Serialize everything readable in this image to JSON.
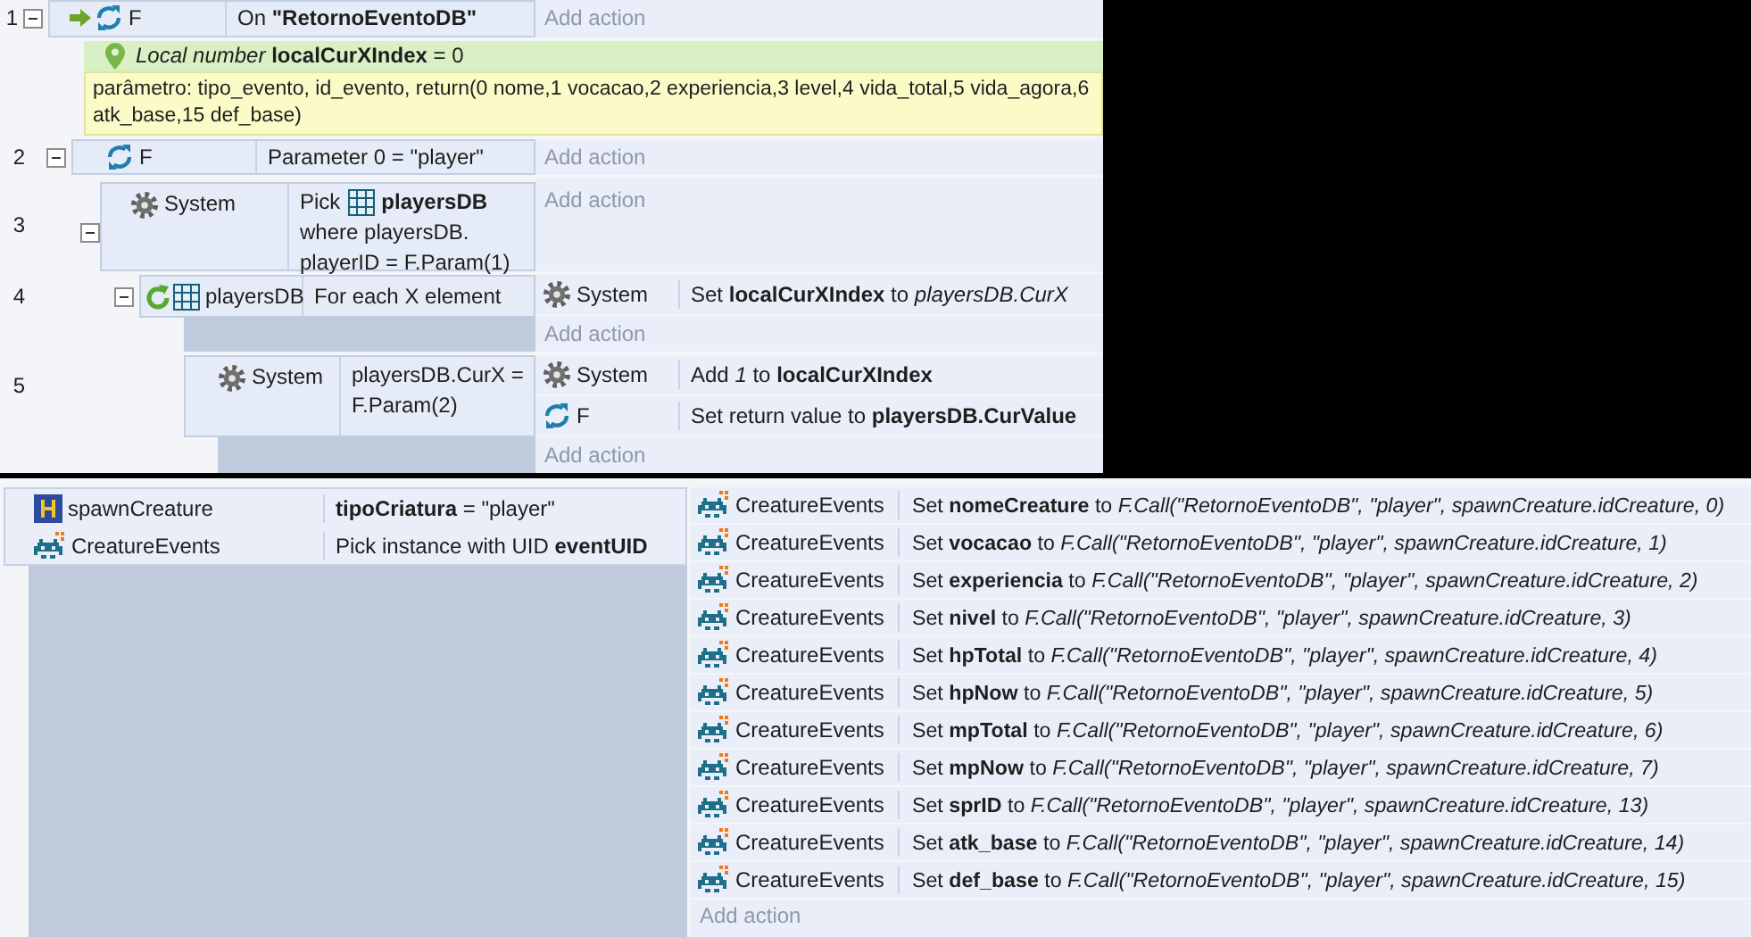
{
  "top_sheet": {
    "event_1": {
      "number": "1",
      "expanded": true,
      "condition": {
        "kind": "trigger",
        "object": "F",
        "text": "On **\"RetornoEventoDB\"**"
      },
      "add_action": "Add action"
    },
    "local_variable": {
      "text": "*Local number* **localCurXIndex** = 0"
    },
    "comment": {
      "lines": [
        "parâmetro: tipo_evento, id_evento, return(0 nome,1 vocacao,2 experiencia,3 level,4 vida_total,5 vida_agora,6",
        "atk_base,15 def_base)"
      ]
    },
    "event_2": {
      "number": "2",
      "expanded": true,
      "condition": {
        "kind": "function",
        "object": "F",
        "text": "Parameter 0 = \"player\""
      },
      "add_action": "Add action"
    },
    "event_3": {
      "number": "3",
      "expanded": true,
      "condition": {
        "kind": "system",
        "object": "System",
        "pick": "Pick",
        "target": "playersDB",
        "lines": [
          "where playersDB.",
          "playerID = F.Param(1)"
        ]
      },
      "add_action": "Add action"
    },
    "event_4": {
      "number": "4",
      "expanded": true,
      "condition": {
        "kind": "for_each",
        "object": "playersDB",
        "text": "For each X element"
      },
      "actions": [
        {
          "kind": "system",
          "object": "System",
          "text": "Set **localCurXIndex** to *playersDB.CurX*"
        }
      ],
      "add_action": "Add action"
    },
    "event_5": {
      "number": "5",
      "condition": {
        "kind": "system",
        "object": "System",
        "lines": [
          "playersDB.CurX =",
          "F.Param(2)"
        ]
      },
      "actions": [
        {
          "kind": "system",
          "object": "System",
          "text": "Add *1* to **localCurXIndex**"
        },
        {
          "kind": "function",
          "object": "F",
          "text": "Set return value to **playersDB.CurValue**"
        }
      ],
      "add_action": "Add action"
    }
  },
  "bottom_sheet": {
    "conditions": [
      {
        "kind": "instance_variable",
        "object": "spawnCreature",
        "text": "**tipoCriatura** = \"player\""
      },
      {
        "kind": "sprite",
        "object": "CreatureEvents",
        "text": "Pick instance with UID **eventUID**"
      }
    ],
    "actions": [
      {
        "kind": "sprite",
        "object": "CreatureEvents",
        "text": "Set **nomeCreature** to *F.Call(\"RetornoEventoDB\", \"player\", spawnCreature.idCreature, 0)*"
      },
      {
        "kind": "sprite",
        "object": "CreatureEvents",
        "text": "Set **vocacao** to *F.Call(\"RetornoEventoDB\", \"player\", spawnCreature.idCreature, 1)*"
      },
      {
        "kind": "sprite",
        "object": "CreatureEvents",
        "text": "Set **experiencia** to *F.Call(\"RetornoEventoDB\", \"player\", spawnCreature.idCreature, 2)*"
      },
      {
        "kind": "sprite",
        "object": "CreatureEvents",
        "text": "Set **nivel** to *F.Call(\"RetornoEventoDB\", \"player\", spawnCreature.idCreature, 3)*"
      },
      {
        "kind": "sprite",
        "object": "CreatureEvents",
        "text": "Set **hpTotal** to *F.Call(\"RetornoEventoDB\", \"player\", spawnCreature.idCreature, 4)*"
      },
      {
        "kind": "sprite",
        "object": "CreatureEvents",
        "text": "Set **hpNow** to *F.Call(\"RetornoEventoDB\", \"player\", spawnCreature.idCreature, 5)*"
      },
      {
        "kind": "sprite",
        "object": "CreatureEvents",
        "text": "Set **mpTotal** to *F.Call(\"RetornoEventoDB\", \"player\", spawnCreature.idCreature, 6)*"
      },
      {
        "kind": "sprite",
        "object": "CreatureEvents",
        "text": "Set **mpNow** to *F.Call(\"RetornoEventoDB\", \"player\", spawnCreature.idCreature, 7)*"
      },
      {
        "kind": "sprite",
        "object": "CreatureEvents",
        "text": "Set **sprID** to *F.Call(\"RetornoEventoDB\", \"player\", spawnCreature.idCreature, 13)*"
      },
      {
        "kind": "sprite",
        "object": "CreatureEvents",
        "text": "Set **atk_base** to *F.Call(\"RetornoEventoDB\", \"player\", spawnCreature.idCreature, 14)*"
      },
      {
        "kind": "sprite",
        "object": "CreatureEvents",
        "text": "Set **def_base** to *F.Call(\"RetornoEventoDB\", \"player\", spawnCreature.idCreature, 15)*"
      }
    ],
    "add_action": "Add action"
  }
}
